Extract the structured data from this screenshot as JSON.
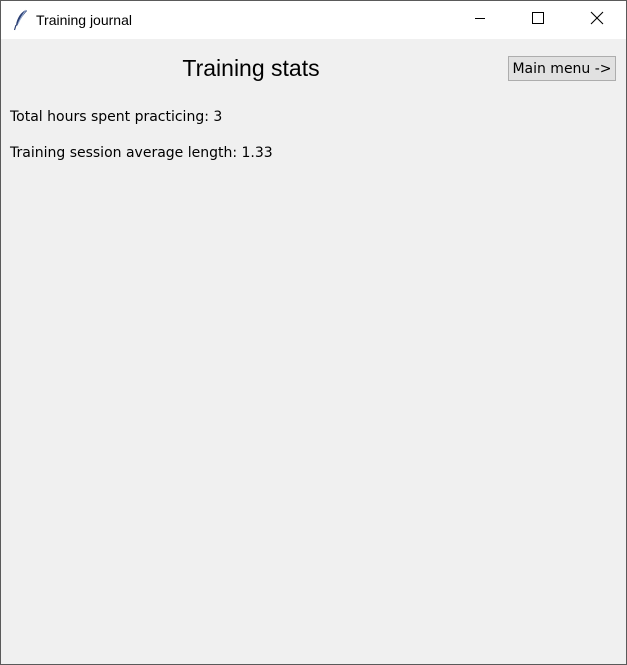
{
  "window": {
    "title": "Training journal",
    "app_icon": "feather-icon",
    "controls": {
      "minimize_icon": "minimize-icon",
      "maximize_icon": "maximize-icon",
      "close_icon": "close-icon"
    }
  },
  "page": {
    "title": "Training stats",
    "main_menu_label": "Main menu ->"
  },
  "stats": {
    "total_hours": "Total hours spent practicing: 3",
    "average_length": "Training session average length: 1.33"
  }
}
